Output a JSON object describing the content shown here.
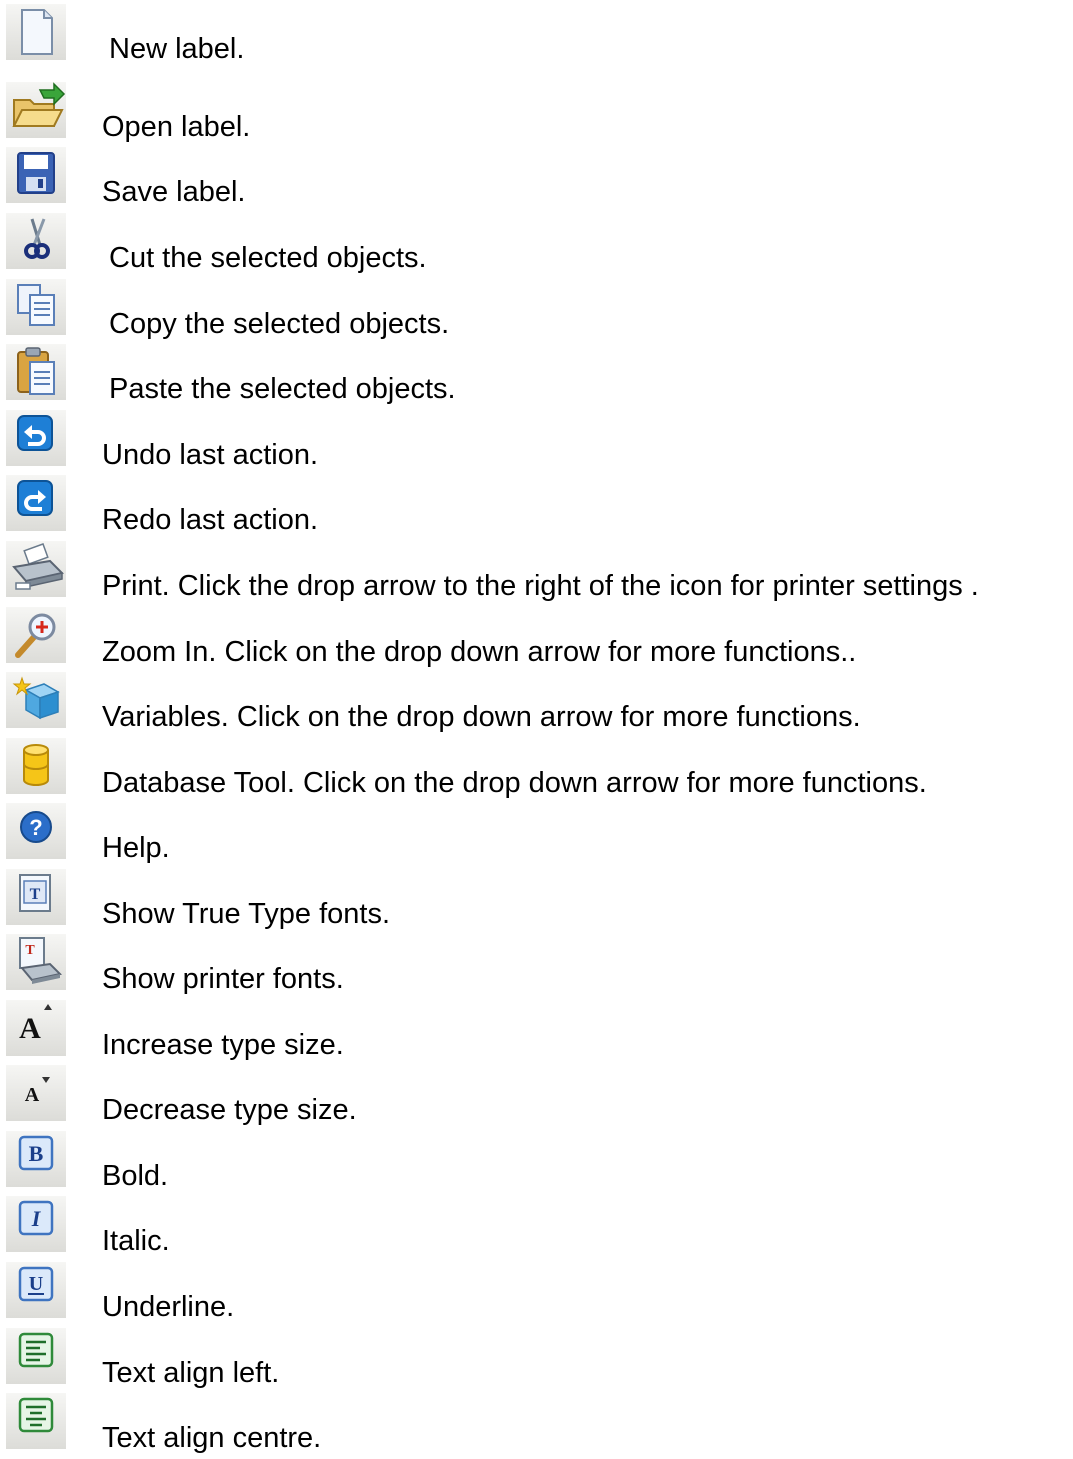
{
  "items": [
    {
      "icon": "new-document-icon",
      "label": "New label."
    },
    {
      "icon": "open-folder-icon",
      "label": "Open label."
    },
    {
      "icon": "save-disk-icon",
      "label": "Save label."
    },
    {
      "icon": "scissors-icon",
      "label": "Cut the selected objects."
    },
    {
      "icon": "copy-icon",
      "label": "Copy the selected objects."
    },
    {
      "icon": "paste-clipboard-icon",
      "label": "Paste the selected objects."
    },
    {
      "icon": "undo-icon",
      "label": "Undo last action."
    },
    {
      "icon": "redo-icon",
      "label": "Redo last action."
    },
    {
      "icon": "printer-icon",
      "label": "Print. Click the drop arrow to the right of the icon for printer settings ."
    },
    {
      "icon": "zoom-in-icon",
      "label": "Zoom In. Click on the drop down arrow for more functions.."
    },
    {
      "icon": "variables-icon",
      "label": "Variables. Click on the drop down arrow  for more functions."
    },
    {
      "icon": "database-icon",
      "label": "Database Tool. Click on the drop down arrow for more functions."
    },
    {
      "icon": "help-icon",
      "label": "Help."
    },
    {
      "icon": "truetype-fonts-icon",
      "label": "Show True Type fonts."
    },
    {
      "icon": "printer-fonts-icon",
      "label": "Show printer fonts."
    },
    {
      "icon": "increase-font-size-icon",
      "label": "Increase type size."
    },
    {
      "icon": "decrease-font-size-icon",
      "label": "Decrease type size."
    },
    {
      "icon": "bold-icon",
      "label": "Bold."
    },
    {
      "icon": "italic-icon",
      "label": "Italic."
    },
    {
      "icon": "underline-icon",
      "label": "Underline."
    },
    {
      "icon": "align-left-icon",
      "label": "Text align left."
    },
    {
      "icon": "align-center-icon",
      "label": "Text align centre."
    }
  ]
}
